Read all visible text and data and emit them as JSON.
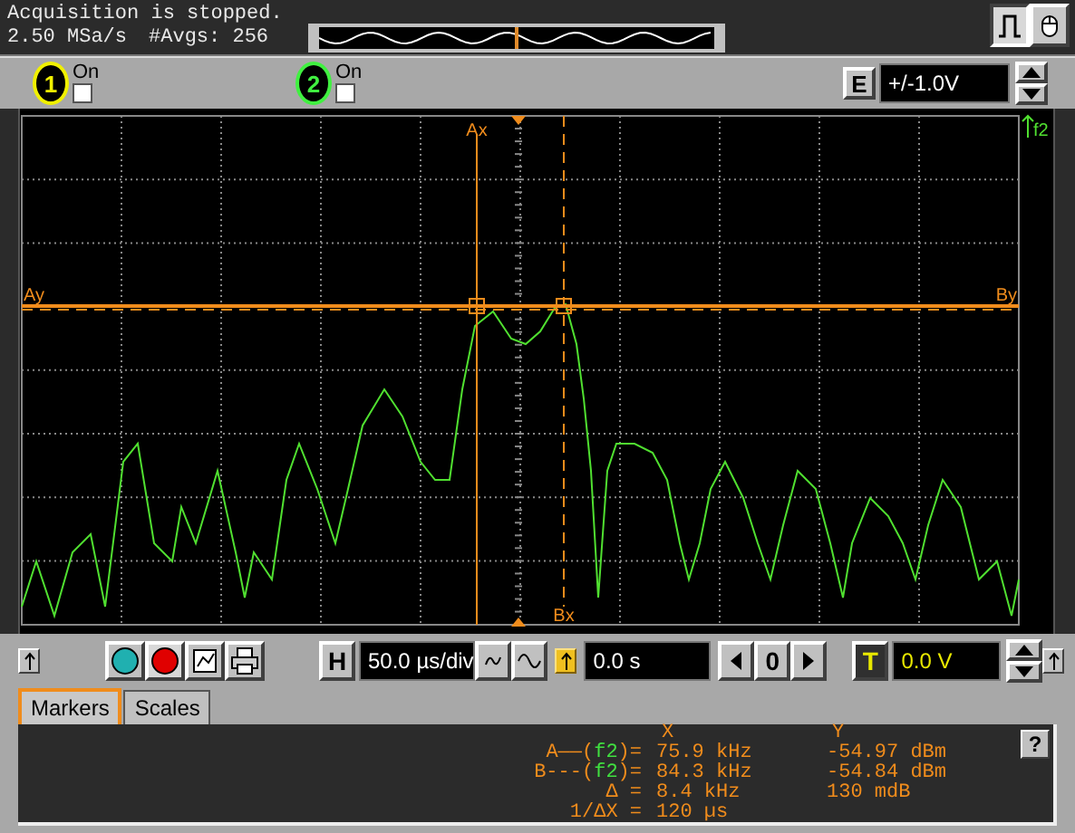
{
  "status": {
    "message": "Acquisition is stopped.",
    "sample_rate": "2.50 MSa/s",
    "averages": "#Avgs: 256"
  },
  "mode_buttons": [
    {
      "selected": true
    },
    {
      "selected": false
    }
  ],
  "channels": [
    {
      "number": "1",
      "label": "On",
      "checked": false,
      "color": "#f0f000"
    },
    {
      "number": "2",
      "label": "On",
      "checked": false,
      "color": "#40f040"
    }
  ],
  "range": {
    "label": "E",
    "value": "+/-1.0V"
  },
  "display": {
    "cursor_a_x": "Ax",
    "cursor_b_x": "Bx",
    "cursor_a_y": "Ay",
    "cursor_b_y": "By",
    "trace_label": "f2"
  },
  "timebase": {
    "label": "H",
    "value": "50.0 µs/div"
  },
  "delay": {
    "value": "0.0 s",
    "reference": "0"
  },
  "trigger": {
    "label": "T",
    "value": "0.0 V"
  },
  "tabs": [
    {
      "label": "Markers",
      "selected": true
    },
    {
      "label": "Scales",
      "selected": false
    }
  ],
  "markers": {
    "columns": [
      "X",
      "Y"
    ],
    "rows": [
      {
        "prefix": "A——(",
        "source": "f2",
        "suffix": ")=",
        "x": "75.9 kHz",
        "y": "-54.97 dBm"
      },
      {
        "prefix": "B---(",
        "source": "f2",
        "suffix": ")=",
        "x": "84.3 kHz",
        "y": "-54.84 dBm"
      },
      {
        "prefix": "Δ =",
        "x": "8.4 kHz",
        "y": "130 mdB"
      },
      {
        "prefix": "1/ΔX =",
        "x": "120 µs"
      }
    ]
  },
  "help": "?"
}
